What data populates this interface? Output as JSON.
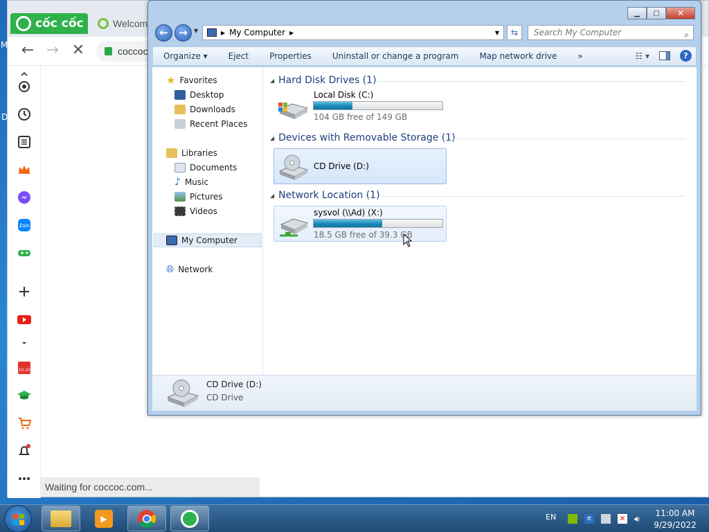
{
  "desktop": {
    "letter_m": "M",
    "letter_d": "D"
  },
  "browser": {
    "logo_text": "cốc cốc",
    "tab_welcome": "Welcom",
    "address_text": "coccoc",
    "status_text": "Waiting for coccoc.com...",
    "sidebar_icons": [
      "settings-icon",
      "history-icon",
      "list-icon",
      "crown-icon",
      "messenger-icon",
      "zalo-icon",
      "gamepad-icon",
      "add-icon",
      "youtube-icon",
      "chevron-down-icon",
      "shop-1010-icon",
      "graduation-icon",
      "cart-icon",
      "bell-icon",
      "more-icon"
    ]
  },
  "explorer": {
    "title": "My Computer",
    "search_placeholder": "Search My Computer",
    "commands": [
      "Organize ▾",
      "Eject",
      "Properties",
      "Uninstall or change a program",
      "Map network drive",
      "»"
    ],
    "nav": {
      "favorites": "Favorites",
      "desktop": "Desktop",
      "downloads": "Downloads",
      "recent": "Recent Places",
      "libraries": "Libraries",
      "documents": "Documents",
      "music": "Music",
      "pictures": "Pictures",
      "videos": "Videos",
      "computer": "My Computer",
      "network": "Network"
    },
    "groups": {
      "hdd": "Hard Disk Drives (1)",
      "removable": "Devices with Removable Storage (1)",
      "network": "Network Location (1)"
    },
    "drives": {
      "c": {
        "name": "Local Disk (C:)",
        "free": "104 GB free of 149 GB",
        "used_fraction": 0.3
      },
      "d": {
        "name": "CD Drive (D:)"
      },
      "x": {
        "name": "sysvol (\\\\Ad) (X:)",
        "free": "18.5 GB free of 39.3 GB",
        "used_fraction": 0.53
      }
    },
    "details": {
      "name": "CD Drive (D:)",
      "type": "CD Drive"
    }
  },
  "taskbar": {
    "lang": "EN",
    "time": "11:00 AM",
    "date": "9/29/2022"
  },
  "colors": {
    "accent": "#2fb24c",
    "bar_fill": "#1b86b4",
    "group_text": "#1e3d7b"
  }
}
